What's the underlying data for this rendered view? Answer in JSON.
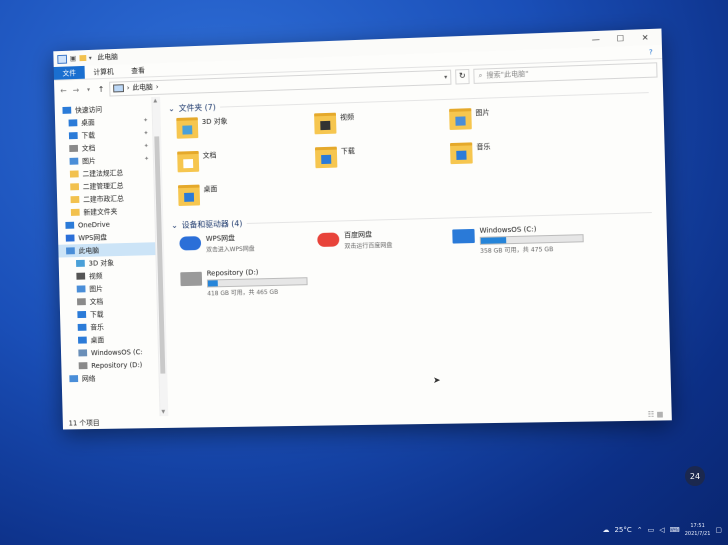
{
  "window": {
    "title": "此电脑",
    "controls": [
      "—",
      "☐",
      "✕"
    ]
  },
  "ribbon": {
    "tabs": [
      "文件",
      "计算机",
      "查看"
    ],
    "help": "?"
  },
  "address": {
    "path": "此电脑",
    "sep": "›",
    "search_placeholder": "搜索\"此电脑\""
  },
  "sidebar": {
    "items": [
      {
        "label": "快速访问",
        "icon": "star-icon",
        "color": "#2b7bd8",
        "pin": false,
        "sel": false,
        "indent": 8
      },
      {
        "label": "桌面",
        "icon": "desktop-icon",
        "color": "#2b7bd8",
        "pin": true,
        "sel": false,
        "indent": 14
      },
      {
        "label": "下载",
        "icon": "download-icon",
        "color": "#2b7bd8",
        "pin": true,
        "sel": false,
        "indent": 14
      },
      {
        "label": "文档",
        "icon": "document-icon",
        "color": "#8a8a8a",
        "pin": true,
        "sel": false,
        "indent": 14
      },
      {
        "label": "图片",
        "icon": "picture-icon",
        "color": "#4a8ed8",
        "pin": true,
        "sel": false,
        "indent": 14
      },
      {
        "label": "二建法规汇总",
        "icon": "folder-icon",
        "color": "#f2c14e",
        "pin": false,
        "sel": false,
        "indent": 14
      },
      {
        "label": "二建管理汇总",
        "icon": "folder-icon",
        "color": "#f2c14e",
        "pin": false,
        "sel": false,
        "indent": 14
      },
      {
        "label": "二建市政汇总",
        "icon": "folder-icon",
        "color": "#f2c14e",
        "pin": false,
        "sel": false,
        "indent": 14
      },
      {
        "label": "新建文件夹",
        "icon": "folder-icon",
        "color": "#f2c14e",
        "pin": false,
        "sel": false,
        "indent": 14
      },
      {
        "label": "OneDrive",
        "icon": "cloud-icon",
        "color": "#2b7bd8",
        "pin": false,
        "sel": false,
        "indent": 8
      },
      {
        "label": "WPS网盘",
        "icon": "cloud-icon",
        "color": "#2b6fd8",
        "pin": false,
        "sel": false,
        "indent": 8
      },
      {
        "label": "此电脑",
        "icon": "computer-icon",
        "color": "#4a8ed8",
        "pin": false,
        "sel": true,
        "indent": 8
      },
      {
        "label": "3D 对象",
        "icon": "3d-objects-icon",
        "color": "#4aa0d8",
        "pin": false,
        "sel": false,
        "indent": 18
      },
      {
        "label": "视频",
        "icon": "video-icon",
        "color": "#555555",
        "pin": false,
        "sel": false,
        "indent": 18
      },
      {
        "label": "图片",
        "icon": "picture-icon",
        "color": "#4a8ed8",
        "pin": false,
        "sel": false,
        "indent": 18
      },
      {
        "label": "文档",
        "icon": "document-icon",
        "color": "#8a8a8a",
        "pin": false,
        "sel": false,
        "indent": 18
      },
      {
        "label": "下载",
        "icon": "download-icon",
        "color": "#2b7bd8",
        "pin": false,
        "sel": false,
        "indent": 18
      },
      {
        "label": "音乐",
        "icon": "music-icon",
        "color": "#2b7bd8",
        "pin": false,
        "sel": false,
        "indent": 18
      },
      {
        "label": "桌面",
        "icon": "desktop-icon",
        "color": "#2b7bd8",
        "pin": false,
        "sel": false,
        "indent": 18
      },
      {
        "label": "WindowsOS (C:",
        "icon": "drive-icon",
        "color": "#6a8fb8",
        "pin": false,
        "sel": false,
        "indent": 18
      },
      {
        "label": "Repository (D:)",
        "icon": "drive-icon",
        "color": "#8a8a8a",
        "pin": false,
        "sel": false,
        "indent": 18
      },
      {
        "label": "网络",
        "icon": "network-icon",
        "color": "#4a8ed8",
        "pin": false,
        "sel": false,
        "indent": 8
      }
    ]
  },
  "folders_group": {
    "title": "文件夹 (7)",
    "items": [
      {
        "label": "3D 对象",
        "overlay": "3d"
      },
      {
        "label": "视频",
        "overlay": "video"
      },
      {
        "label": "图片",
        "overlay": "picture"
      },
      {
        "label": "文档",
        "overlay": "document"
      },
      {
        "label": "下载",
        "overlay": "download"
      },
      {
        "label": "音乐",
        "overlay": "music"
      },
      {
        "label": "桌面",
        "overlay": "desktop"
      }
    ]
  },
  "drives_group": {
    "title": "设备和驱动器 (4)",
    "items": [
      {
        "name": "WPS网盘",
        "sub": "双击进入WPS网盘",
        "icon": "wps-cloud-icon",
        "usage": null
      },
      {
        "name": "百度网盘",
        "sub": "双击运行百度网盘",
        "icon": "baidu-netdisk-icon",
        "usage": null
      },
      {
        "name": "WindowsOS (C:)",
        "sub": "358 GB 可用，共 475 GB",
        "icon": "windows-drive-icon",
        "usage": 0.25
      },
      {
        "name": "Repository (D:)",
        "sub": "418 GB 可用，共 465 GB",
        "icon": "hard-drive-icon",
        "usage": 0.1
      }
    ]
  },
  "status": {
    "count": "11 个项目",
    "views": "☷ ▦"
  },
  "taskbar": {
    "weather": "25°C",
    "time": "17:51",
    "date": "2021/7/21",
    "widget": "24"
  },
  "colors": {
    "accent": "#1a6fd0",
    "selection": "#cce4f7",
    "folder": "#f6c64f"
  }
}
